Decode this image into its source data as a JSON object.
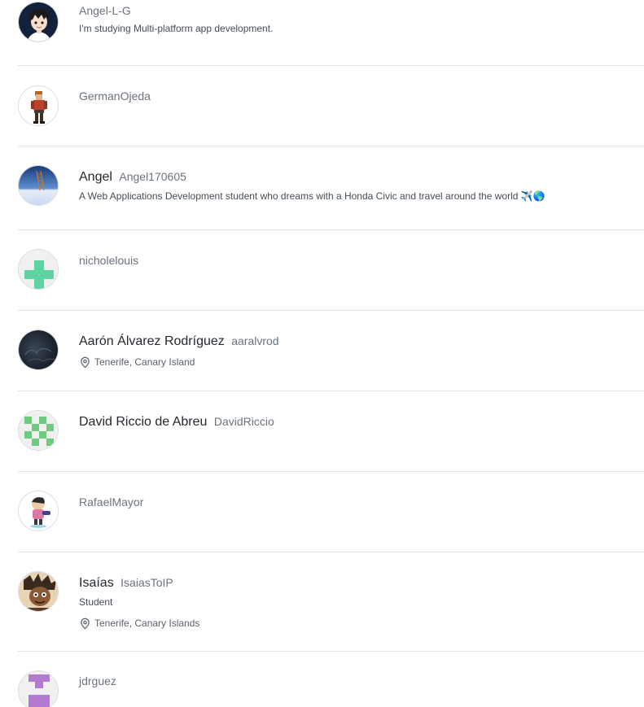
{
  "users": [
    {
      "full_name": "",
      "login": "Angel-L-G",
      "bio": "I'm studying Multi-platform app development.",
      "location": "",
      "avatar": "anime-boy-avatar",
      "accent": "#1b2a3a"
    },
    {
      "full_name": "",
      "login": "GermanOjeda",
      "bio": "",
      "location": "",
      "avatar": "soldier-figure-avatar",
      "accent": "#a34a28"
    },
    {
      "full_name": "Angel",
      "login": "Angel170605",
      "bio": "A Web Applications Development student who dreams with a Honda Civic and travel around the world ✈️🌎",
      "location": "",
      "avatar": "sky-ladder-avatar",
      "accent": "#3a6fb5"
    },
    {
      "full_name": "",
      "login": "nicholelouis",
      "bio": "",
      "location": "",
      "avatar": "identicon-avatar",
      "accent": "#5fd4a0"
    },
    {
      "full_name": "Aarón Álvarez Rodríguez",
      "login": "aaralvrod",
      "bio": "",
      "location": "Tenerife, Canary Island",
      "avatar": "dark-night-avatar",
      "accent": "#1c2533"
    },
    {
      "full_name": "David Riccio de Abreu",
      "login": "DavidRiccio",
      "bio": "",
      "location": "",
      "avatar": "identicon-avatar",
      "accent": "#6ccb7f"
    },
    {
      "full_name": "",
      "login": "RafaelMayor",
      "bio": "",
      "location": "",
      "avatar": "cartoon-character-avatar",
      "accent": "#d97aa5"
    },
    {
      "full_name": "Isaías",
      "login": "IsaiasToIP",
      "bio": "Student",
      "location": "Tenerife, Canary Islands",
      "avatar": "illustrated-portrait-avatar",
      "accent": "#6b4a2f"
    },
    {
      "full_name": "",
      "login": "jdrguez",
      "bio": "",
      "location": "",
      "avatar": "identicon-avatar",
      "accent": "#b27ad1"
    }
  ]
}
